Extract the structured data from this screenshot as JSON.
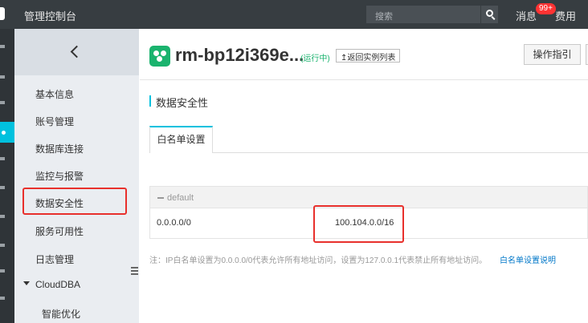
{
  "topbar": {
    "title": "管理控制台",
    "search_placeholder": "搜索",
    "messages_label": "消息",
    "messages_badge": "99+",
    "fees_label": "费用"
  },
  "sidebar": {
    "items": [
      {
        "label": "基本信息"
      },
      {
        "label": "账号管理"
      },
      {
        "label": "数据库连接"
      },
      {
        "label": "监控与报警"
      },
      {
        "label": "数据安全性",
        "highlighted": true
      },
      {
        "label": "服务可用性"
      },
      {
        "label": "日志管理"
      },
      {
        "label": "CloudDBA",
        "expanded": true
      },
      {
        "label": "智能优化"
      }
    ]
  },
  "instance": {
    "name": "rm-bp12i369e...",
    "status": "(运行中)",
    "back_label": "返回实例列表",
    "guide_label": "操作指引"
  },
  "section": {
    "title": "数据安全性",
    "tabs": [
      {
        "label": "白名单设置",
        "active": true
      }
    ]
  },
  "whitelist": {
    "group_name": "default",
    "rows": [
      {
        "ip_range": "0.0.0.0/0",
        "value": "100.104.0.0/16"
      }
    ]
  },
  "note": {
    "text": "注：IP白名单设置为0.0.0.0/0代表允许所有地址访问，设置为127.0.0.1代表禁止所有地址访问。",
    "link": "白名单设置说明"
  },
  "colors": {
    "topbar": "#373d41",
    "accent": "#00c1de",
    "highlight": "#e8302c",
    "status_green": "#1ab36e",
    "link": "#0077c8"
  }
}
